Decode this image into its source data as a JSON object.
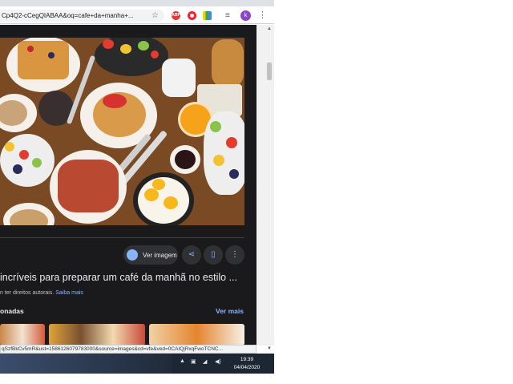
{
  "browser": {
    "url": "Cp4Q2-cCegQIABAA&oq=cafe+da+manha+...",
    "bookmark_icon": "star-icon",
    "extensions": [
      "ABP",
      "Opera",
      "Colors"
    ],
    "profile_initial": "k"
  },
  "viewer": {
    "view_image_label": "Ver imagem",
    "title": "incríveis para preparar um café da manhã no estilo ...",
    "rights_text": "n ter direitos autorais.",
    "learn_more": "Saiba mais",
    "related_heading": "onadas",
    "see_more": "Ver mais"
  },
  "status_url": "qSzfBkCv5mR&ust=1586126079783000&source=images&cd=vfe&ved=0CAIQjRxqFwoTCNC...",
  "taskbar": {
    "time": "19:39",
    "date": "04/04/2020"
  },
  "colors": {
    "panel_bg": "#1a1a1d",
    "accent": "#8ab4f8",
    "text": "#e8eaed"
  }
}
